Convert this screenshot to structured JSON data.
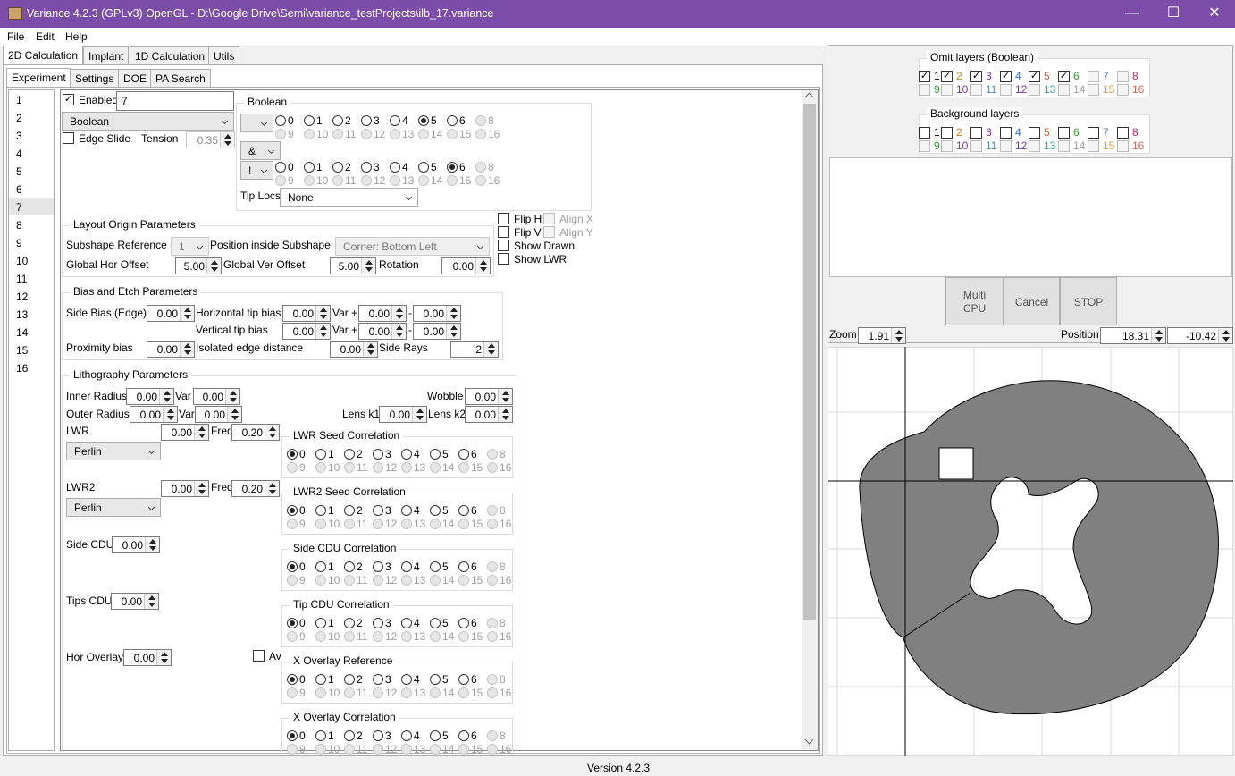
{
  "window": {
    "title": "Variance 4.2.3 (GPLv3) OpenGL - D:\\Google Drive\\Semi\\variance_testProjects\\ilb_17.variance",
    "minimize": "—",
    "maximize": "☐",
    "close": "✕"
  },
  "menu": [
    "File",
    "Edit",
    "Help"
  ],
  "main_tabs": [
    "2D Calculation",
    "Implant",
    "1D Calculation",
    "Utils"
  ],
  "sub_tabs": [
    "Experiment",
    "Settings",
    "DOE",
    "PA Search"
  ],
  "shape_list": [
    "1",
    "2",
    "3",
    "4",
    "5",
    "6",
    "7",
    "8",
    "9",
    "10",
    "11",
    "12",
    "13",
    "14",
    "15",
    "16"
  ],
  "shape": {
    "enabled_label": "Enabled",
    "name": "7",
    "type": "Boolean",
    "edge_slide_label": "Edge Slide",
    "tension_label": "Tension",
    "tension": "0.35"
  },
  "boolean": {
    "title": "Boolean",
    "op_a": "",
    "op_mid": "&",
    "op_b": "!",
    "tip_locs_label": "Tip Locs",
    "tip_locs": "None"
  },
  "layer_labels": [
    "0",
    "1",
    "2",
    "3",
    "4",
    "5",
    "6",
    "8",
    "9",
    "10",
    "11",
    "12",
    "13",
    "14",
    "15",
    "16"
  ],
  "flip": {
    "flip_h": "Flip H",
    "align_x": "Align X",
    "flip_v": "Flip V",
    "align_y": "Align Y",
    "show_drawn": "Show Drawn",
    "show_lwr": "Show LWR"
  },
  "layout": {
    "title": "Layout Origin Parameters",
    "subshape_ref_label": "Subshape Reference",
    "subshape_ref": "1",
    "pos_label": "Position inside Subshape",
    "pos": "Corner: Bottom Left",
    "ghor_label": "Global Hor Offset",
    "ghor": "5.00",
    "gver_label": "Global Ver Offset",
    "gver": "5.00",
    "rot_label": "Rotation",
    "rot": "0.00"
  },
  "bias": {
    "title": "Bias and Etch Parameters",
    "side_label": "Side Bias (Edge)",
    "side": "0.00",
    "htip_label": "Horizontal tip bias",
    "htip": "0.00",
    "vtip_label": "Vertical tip bias",
    "vtip": "0.00",
    "var_plus": "Var +",
    "minus": "-",
    "hvarp": "0.00",
    "hvarm": "0.00",
    "vvarp": "0.00",
    "vvarm": "0.00",
    "prox_label": "Proximity bias",
    "prox": "0.00",
    "iso_label": "Isolated edge distance",
    "iso": "0.00",
    "rays_label": "Side Rays",
    "rays": "2"
  },
  "litho": {
    "title": "Lithography Parameters",
    "inner_label": "Inner Radius",
    "inner": "0.00",
    "outer_label": "Outer Radius",
    "outer": "0.00",
    "var_label": "Var",
    "inner_var": "0.00",
    "outer_var": "0.00",
    "wobble_label": "Wobble",
    "wobble": "0.00",
    "k1_label": "Lens k1",
    "k1": "0.00",
    "k2_label": "Lens k2",
    "k2": "0.00",
    "lwr_label": "LWR",
    "lwr": "0.00",
    "freq_label": "Freq",
    "lwr_freq": "0.20",
    "lwr_noise": "Perlin",
    "lwr2_label": "LWR2",
    "lwr2": "0.00",
    "lwr2_freq": "0.20",
    "lwr2_noise": "Perlin",
    "side_cdu_label": "Side CDU",
    "side_cdu": "0.00",
    "tips_cdu_label": "Tips CDU",
    "tips_cdu": "0.00",
    "hor_overlay_label": "Hor Overlay",
    "hor_overlay": "0.00",
    "av_label": "Av"
  },
  "correlations": [
    "LWR Seed Correlation",
    "LWR2 Seed Correlation",
    "Side CDU Correlation",
    "Tip CDU Correlation",
    "X Overlay Reference",
    "X Overlay Correlation"
  ],
  "right": {
    "omit_title": "Omit layers (Boolean)",
    "bg_title": "Background layers",
    "layer_nums": [
      "1",
      "2",
      "3",
      "4",
      "5",
      "6",
      "7",
      "8",
      "9",
      "10",
      "11",
      "12",
      "13",
      "14",
      "15",
      "16"
    ],
    "layer_colors": [
      "#000000",
      "#e07a00",
      "#7a2fb0",
      "#2b6fd6",
      "#e0541b",
      "#3a9b35",
      "#4a7bd6",
      "#c02070",
      "#3a9b35",
      "#7a2fb0",
      "#5a8ab0",
      "#7a2fb0",
      "#2aa0b0",
      "#a0a0a0",
      "#e09a40",
      "#d06a50"
    ],
    "multi_cpu": "Multi\nCPU",
    "cancel": "Cancel",
    "stop": "STOP",
    "zoom_label": "Zoom",
    "zoom": "1.91",
    "position_label": "Position",
    "pos_x": "18.31",
    "pos_y": "-10.42"
  },
  "status": "Version 4.2.3"
}
